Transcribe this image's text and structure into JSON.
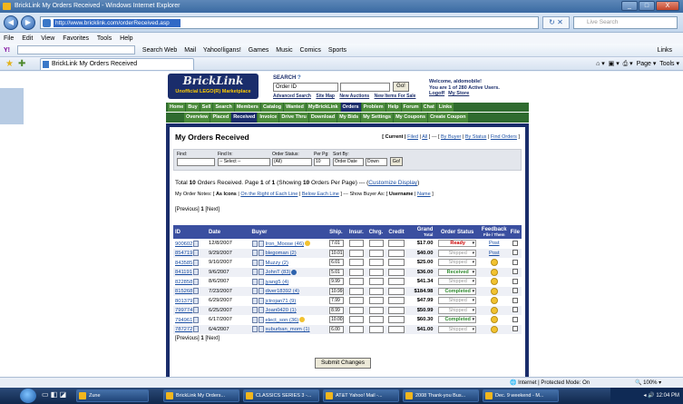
{
  "window": {
    "title": "BrickLink My Orders Received - Windows Internet Explorer",
    "address": "http://www.bricklink.com/orderReceived.asp",
    "live_search_placeholder": "Live Search",
    "min": "_",
    "max": "□",
    "close": "X"
  },
  "menu": [
    "File",
    "Edit",
    "View",
    "Favorites",
    "Tools",
    "Help"
  ],
  "toolbar": [
    "Y!",
    "Search Web",
    "Mail",
    "Yahoo!ligans!",
    "Games",
    "Music",
    "Comics",
    "Sports"
  ],
  "toolbar_links": "Links",
  "tab": {
    "label": "BrickLink My Orders Received"
  },
  "ie_tools": {
    "page": "Page",
    "tools": "Tools"
  },
  "site": {
    "logo": "BrickLink",
    "logo_sub": "Unofficial LEGO(R) Marketplace",
    "search_label": "SEARCH",
    "search_type": "Order ID",
    "go": "Go!",
    "search_links": [
      "Advanced Search",
      "Site Map",
      "New Auctions",
      "New Items For Sale"
    ],
    "welcome_line1": "Welcome, aldomobile!",
    "welcome_line2": "You are 1 of 280 Active Users.",
    "logoff": "Logoff",
    "mystore": "My Store",
    "nav1": [
      "Home",
      "Buy",
      "Sell",
      "Search",
      "Members",
      "Catalog",
      "Wanted",
      "MyBrickLink",
      "Orders",
      "Problem",
      "Help",
      "Forum",
      "Chat",
      "Links"
    ],
    "nav1_active": "Orders",
    "nav2": [
      "Overview",
      "Placed",
      "Received",
      "Invoice",
      "Drive Thru",
      "Download",
      "My Bids",
      "My Settings",
      "My Coupons",
      "Create Coupon"
    ],
    "nav2_active": "Received"
  },
  "panel": {
    "title": "My Orders Received",
    "filter_current": "[ Current |",
    "filter_filed": "Filed",
    "filter_sep": "|",
    "filter_all": "All",
    "filter_close": "] --- [",
    "filter_by_buyer": "By Buyer",
    "filter_by_status": "By Status",
    "filter_find": "Find Orders",
    "filter_end": "]",
    "find_label": "Find:",
    "find_in_label": "Find In:",
    "find_in_value": "-- Select --",
    "status_label": "Order Status:",
    "status_value": "(All)",
    "perpg_label": "Per Pg:",
    "perpg_value": "10",
    "sortby_label": "Sort By:",
    "sortby_value": "Order Date",
    "sortdir_value": "Down",
    "go": "Go!",
    "summary_pre": "Total ",
    "summary_total": "10",
    "summary_mid": " Orders Received. Page ",
    "summary_page": "1",
    "summary_of": " of ",
    "summary_pages": "1",
    "summary_showing": " (Showing ",
    "summary_showing_n": "10",
    "summary_post": " Orders Per Page) --- (",
    "summary_customize": "Customize Display",
    "summary_end": ")",
    "notes_pre": "My Order Notes: [",
    "notes_as_icons": "As Icons",
    "notes_sep1": "|",
    "notes_right": "On the Right of Each Line",
    "notes_sep2": "|",
    "notes_below": "Below Each Line",
    "notes_mid": "] --- Show Buyer As: [",
    "notes_username": "Username",
    "notes_sep3": "|",
    "notes_name": "Name",
    "notes_end": "]",
    "pager_prev": "[Previous]",
    "pager_page": "1",
    "pager_next": "[Next]",
    "submit": "Submit Changes"
  },
  "table": {
    "headers": {
      "id": "ID",
      "date": "Date",
      "buyer": "Buyer",
      "ship": "Ship.",
      "insur": "Insur.",
      "chrg": "Chrg.",
      "credit": "Credit",
      "grand": "Grand",
      "grand_sub": "Total",
      "status": "Order Status",
      "feedback": "Feedback",
      "feedback_sub": "File / Them",
      "file": "File"
    },
    "rows": [
      {
        "id": "900602",
        "date": "12/8/2007",
        "buyer": "Iron_Moose (46)",
        "ship": "7.01",
        "total": "$17.00",
        "status": "Ready",
        "feedback": "Post",
        "status_color": "#cc0000",
        "badge": "#f2c230"
      },
      {
        "id": "854719",
        "date": "9/29/2007",
        "buyer": "blegoman (2)",
        "ship": "10.01",
        "total": "$40.00",
        "status": "Shipped",
        "feedback": "Post",
        "status_color": "#999999",
        "badge": ""
      },
      {
        "id": "843585",
        "date": "9/10/2007",
        "buyer": "Muzzy (2)",
        "ship": "6.01",
        "total": "$25.00",
        "status": "Shipped",
        "feedback": "smile",
        "status_color": "#999999",
        "badge": ""
      },
      {
        "id": "841191",
        "date": "9/6/2007",
        "buyer": "JohnT (83)",
        "ship": "5.01",
        "total": "$36.00",
        "status": "Received",
        "feedback": "smile",
        "status_color": "#2e8b2e",
        "badge": "#2d62ad"
      },
      {
        "id": "822858",
        "date": "8/6/2007",
        "buyer": "jyang5 (4)",
        "ship": "9.99",
        "total": "$41.34",
        "status": "Shipped",
        "feedback": "smile",
        "status_color": "#999999",
        "badge": ""
      },
      {
        "id": "815268",
        "date": "7/23/2007",
        "buyer": "diver18392 (4)",
        "ship": "10.99",
        "total": "$184.98",
        "status": "Completed",
        "feedback": "smile",
        "status_color": "#2e8b2e",
        "badge": ""
      },
      {
        "id": "801379",
        "date": "6/29/2007",
        "buyer": "jctrojan71 (9)",
        "ship": "7.99",
        "total": "$47.99",
        "status": "Shipped",
        "feedback": "smile",
        "status_color": "#999999",
        "badge": ""
      },
      {
        "id": "799774",
        "date": "6/25/2007",
        "buyer": "Joan0420 (1)",
        "ship": "8.99",
        "total": "$50.99",
        "status": "Shipped",
        "feedback": "smile",
        "status_color": "#999999",
        "badge": ""
      },
      {
        "id": "794961",
        "date": "6/17/2007",
        "buyer": "elect_son (36)",
        "ship": "10.00",
        "total": "$60.30",
        "status": "Completed",
        "feedback": "smile",
        "status_color": "#2e8b2e",
        "badge": "#f2c230"
      },
      {
        "id": "787272",
        "date": "6/4/2007",
        "buyer": "suburban_mom (1)",
        "ship": "6.00",
        "total": "$41.00",
        "status": "Shipped",
        "feedback": "smile",
        "status_color": "#999999",
        "badge": ""
      }
    ]
  },
  "statusbar": {
    "zone": "Internet | Protected Mode: On",
    "zoom": "100%"
  },
  "taskbar": {
    "items": [
      "Zune",
      "BrickLink My Orders...",
      "CLASSICS SERIES 3 -...",
      "AT&T Yahoo! Mail -...",
      "2008 Thank-you Bus...",
      "Dec. 9 weekend - M..."
    ],
    "clock": "12:04 PM"
  }
}
